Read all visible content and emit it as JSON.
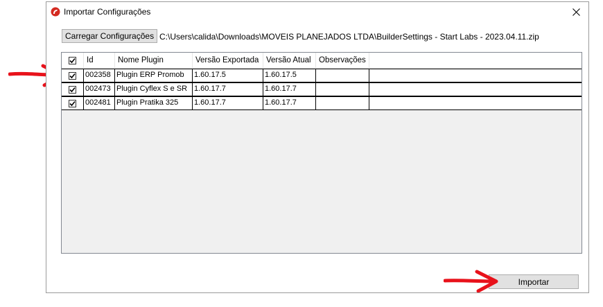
{
  "window": {
    "title": "Importar Configurações"
  },
  "toolbar": {
    "load_label": "Carregar Configurações",
    "path": "C:\\Users\\calida\\Downloads\\MOVEIS PLANEJADOS LTDA\\BuilderSettings - Start Labs - 2023.04.11.zip"
  },
  "grid": {
    "columns": [
      "Id",
      "Nome Plugin",
      "Versão Exportada",
      "Versão Atual",
      "Observações"
    ],
    "header_checked": true,
    "rows": [
      {
        "checked": true,
        "id": "002358",
        "name": "Plugin ERP Promob",
        "exported": "1.60.17.5",
        "current": "1.60.17.5",
        "obs": ""
      },
      {
        "checked": true,
        "id": "002473",
        "name": "Plugin Cyflex S e SR",
        "exported": "1.60.17.7",
        "current": "1.60.17.7",
        "obs": ""
      },
      {
        "checked": true,
        "id": "002481",
        "name": "Plugin Pratika 325",
        "exported": "1.60.17.7",
        "current": "1.60.17.7",
        "obs": ""
      }
    ]
  },
  "footer": {
    "import_label": "Importar"
  },
  "icons": {
    "app": "red-app-logo-icon",
    "close": "close-icon",
    "check": "checkmark-icon",
    "annotation": "red-arrow-icon"
  },
  "colors": {
    "annotation": "#e8121b",
    "app_icon": "#d42a20"
  }
}
